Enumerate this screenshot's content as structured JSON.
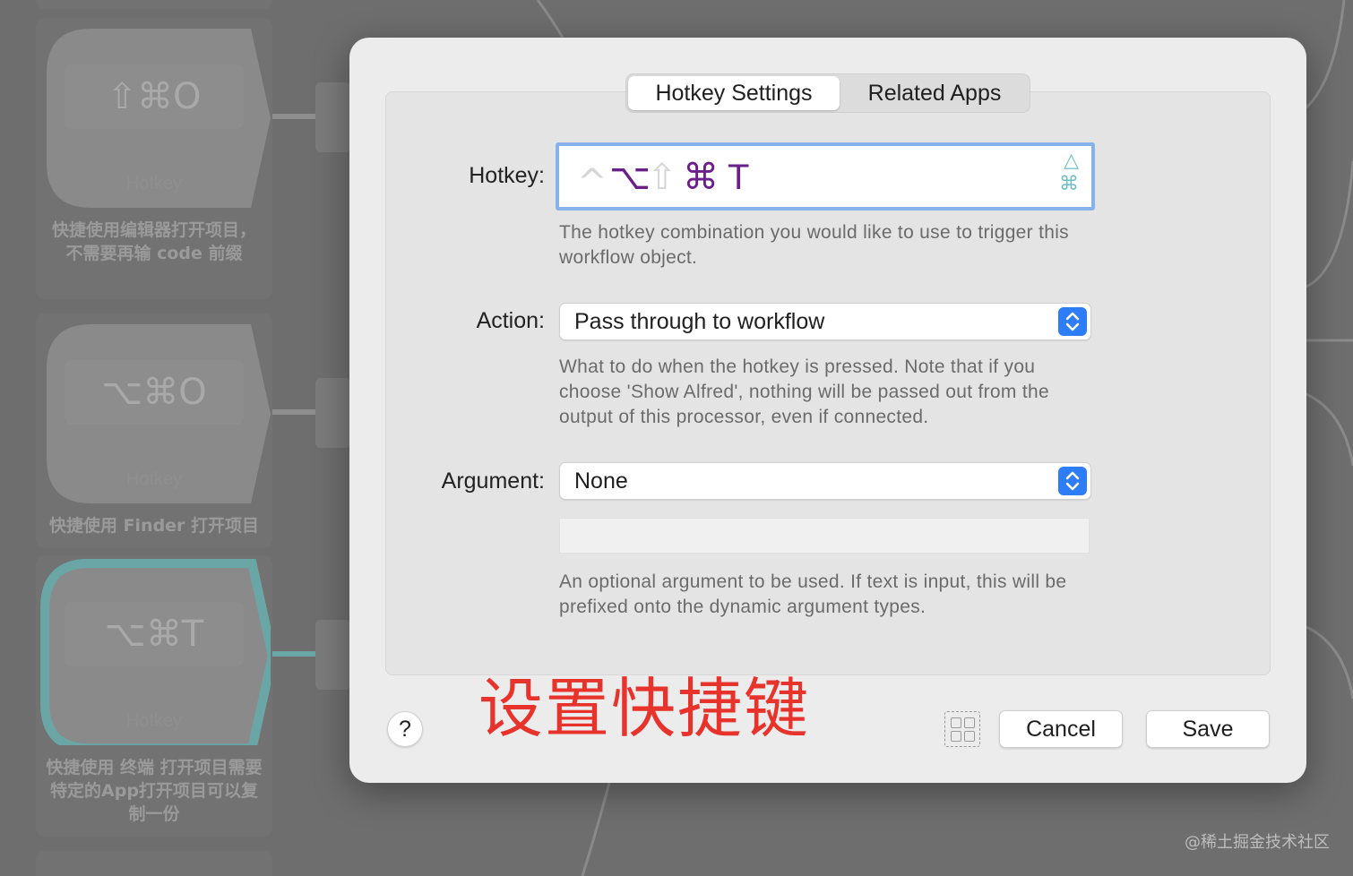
{
  "canvas": {
    "top_node_partial_text": "",
    "nodes": [
      {
        "key": "⇧⌘O",
        "type": "Hotkey",
        "desc": "快捷使用编辑器打开项目，不需要再输 code 前缀",
        "selected": false
      },
      {
        "key": "⌥⌘O",
        "type": "Hotkey",
        "desc": "快捷使用 Finder 打开项目",
        "selected": false
      },
      {
        "key": "⌥⌘T",
        "type": "Hotkey",
        "desc": "快捷使用 终端 打开项目需要特定的App打开项目可以复制一份",
        "selected": true
      }
    ]
  },
  "dialog": {
    "tabs": [
      {
        "label": "Hotkey Settings",
        "active": true
      },
      {
        "label": "Related Apps",
        "active": false
      }
    ],
    "hotkey": {
      "label": "Hotkey:",
      "symbols": {
        "ctrl": "^",
        "opt": "⌥",
        "shift": "⇧",
        "cmd": "⌘",
        "key": "T"
      },
      "help": "The hotkey combination you would like to use to trigger this workflow object."
    },
    "action": {
      "label": "Action:",
      "value": "Pass through to workflow",
      "help": "What to do when the hotkey is pressed. Note that if you choose 'Show Alfred', nothing will be passed out from the output of this processor, even if connected."
    },
    "argument": {
      "label": "Argument:",
      "value": "None",
      "text_value": "",
      "help": "An optional argument to be used. If text is input, this will be prefixed onto the dynamic argument types."
    },
    "help_button": "?",
    "annotation": "设置快捷键",
    "cancel_label": "Cancel",
    "save_label": "Save"
  },
  "watermark": "@稀土掘金技术社区",
  "colors": {
    "accent": "#2d7df6",
    "focus_ring": "#86b3ea",
    "selected_node": "#6aa6a6",
    "annotation": "#e8332c",
    "hotkey_active": "#6b1f8a"
  }
}
